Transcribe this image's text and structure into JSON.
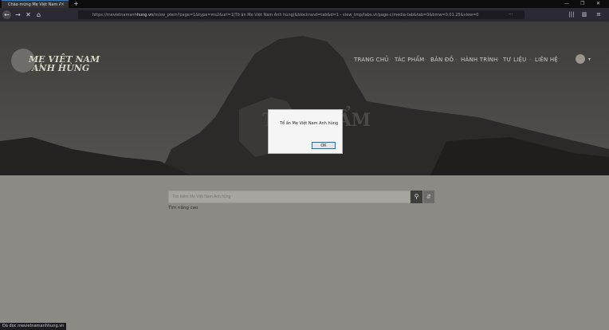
{
  "browser": {
    "tab_title": "Chào mừng Mẹ Việt Nam Anh",
    "tab_close": "×",
    "new_tab": "+",
    "window_minimize": "—",
    "window_maximize": "❐",
    "window_close": "✕",
    "back": "←",
    "forward": "→",
    "stop": "✕",
    "home": "⌂",
    "url_prefix": "https://mevietnamanh",
    "url_domain": "hung.vn",
    "url_rest": "/m/sw_ptem?page=1&type=ms2&url=1|Tổ ấn Mẹ Việt Nam Anh hùng|&blockrand=tab&d=1 - view_tmp/tabs.vt/page-c/media-tab&tab=0&bmw=0.01.25&view=0",
    "more_icon": "···",
    "library_icon": "|||",
    "sidebar_icon": "▥",
    "menu_icon": "≡"
  },
  "site": {
    "logo_line1": "MẸ VIỆT NAM",
    "logo_line2": "ANH HÙNG",
    "nav": [
      "TRANG CHỦ",
      "TÁC PHẨM",
      "BẢN ĐỒ",
      "HÀNH TRÌNH",
      "TƯ LIỆU",
      "LIÊN HỆ"
    ],
    "nav_separator": "·",
    "lang_caret": "▾",
    "hero_title": "TÁC PHẨM"
  },
  "search": {
    "placeholder": "Tìm kiếm Mẹ Việt Nam Anh hùng",
    "search_icon": "⚲",
    "filter_icon": "⇵",
    "advanced_link": "Tìm nâng cao"
  },
  "dialog": {
    "message": "Tổ ấn Mẹ Việt Nam Anh hùng",
    "ok_label": "OK"
  },
  "status_bar": {
    "text": "Đã đọc mevietnamanhhung.vn"
  }
}
